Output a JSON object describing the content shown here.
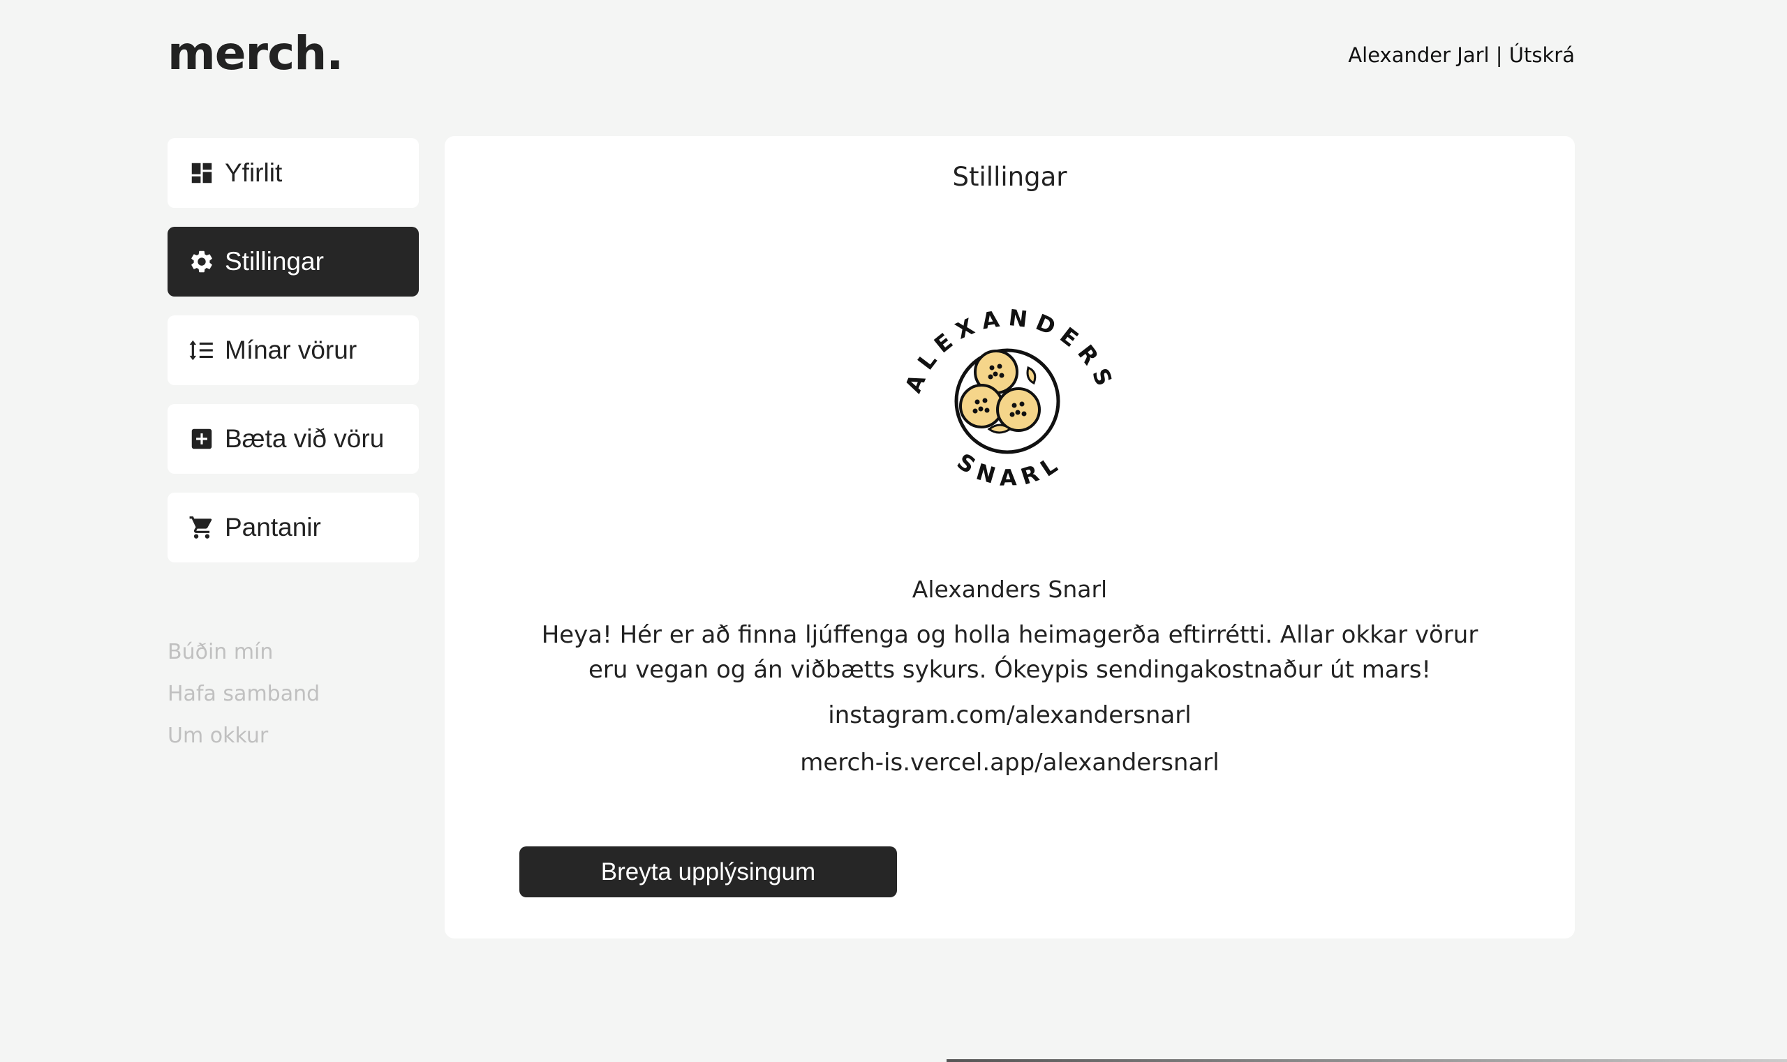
{
  "header": {
    "logo": "merch.",
    "user_name": "Alexander Jarl",
    "separator": "|",
    "logout_label": "Útskrá"
  },
  "nav": {
    "items": [
      {
        "label": "Yfirlit",
        "icon": "dashboard-icon",
        "active": false
      },
      {
        "label": "Stillingar",
        "icon": "gear-icon",
        "active": true
      },
      {
        "label": "Mínar vörur",
        "icon": "sort-list-icon",
        "active": false
      },
      {
        "label": "Bæta við vöru",
        "icon": "add-box-icon",
        "active": false
      },
      {
        "label": "Pantanir",
        "icon": "cart-icon",
        "active": false
      }
    ]
  },
  "footer_links": [
    "Búðin mín",
    "Hafa samband",
    "Um okkur"
  ],
  "main": {
    "title": "Stillingar",
    "logo_text_top": "ALEXANDERS",
    "logo_text_bottom": "SNARL",
    "shop_name": "Alexanders Snarl",
    "description": "Heya! Hér er að finna ljúffenga og holla heimagerða eftirrétti. Allar okkar vörur eru vegan og án viðbætts sykurs. Ókeypis sendingakostnaður út mars!",
    "instagram": "instagram.com/alexandersnarl",
    "shop_url": "merch-is.vercel.app/alexandersnarl",
    "edit_button_label": "Breyta upplýsingum"
  },
  "colors": {
    "background": "#f4f5f4",
    "active_nav": "#262626",
    "muted_link": "#c0c0c0",
    "logo_fill": "#f5d58a"
  }
}
